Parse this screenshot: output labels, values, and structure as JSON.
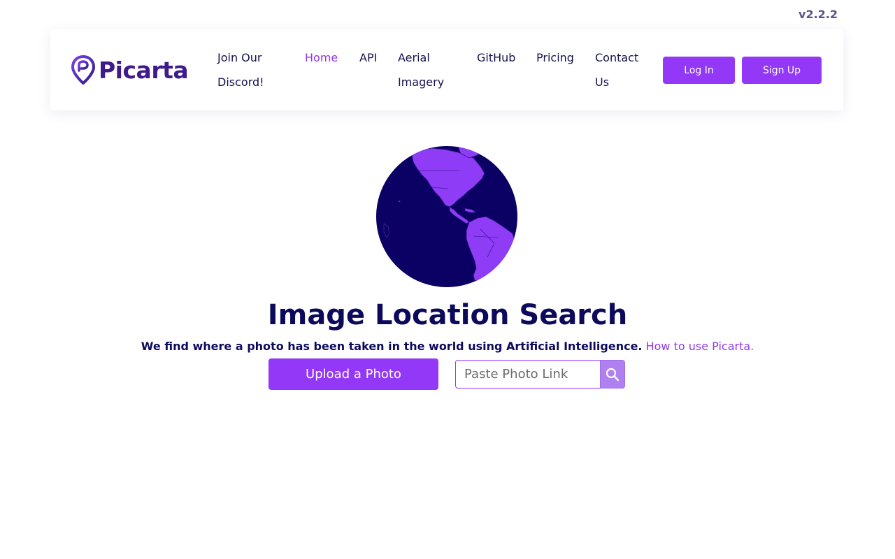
{
  "version": "v2.2.2",
  "brand": {
    "name": "Picarta",
    "accent": "#9438f7",
    "dark": "#0d0a5c"
  },
  "nav": {
    "links": [
      {
        "label": "Join Our\nDiscord!",
        "line1": "Join Our",
        "line2": "Discord!"
      },
      {
        "label": "Home",
        "active": true
      },
      {
        "label": "API"
      },
      {
        "label": "Aerial\nImagery",
        "line1": "Aerial",
        "line2": "Imagery"
      },
      {
        "label": "GitHub"
      },
      {
        "label": "Pricing"
      },
      {
        "label": "Contact\nUs",
        "line1": "Contact",
        "line2": "Us"
      }
    ],
    "login_label": "Log In",
    "signup_label": "Sign Up"
  },
  "hero": {
    "title": "Image Location Search",
    "subtitle": "We find where a photo has been taken in the world using Artificial Intelligence.",
    "help_link": "How to use Picarta.",
    "upload_label": "Upload a Photo",
    "link_placeholder": "Paste Photo Link",
    "search_icon": "search-icon"
  }
}
